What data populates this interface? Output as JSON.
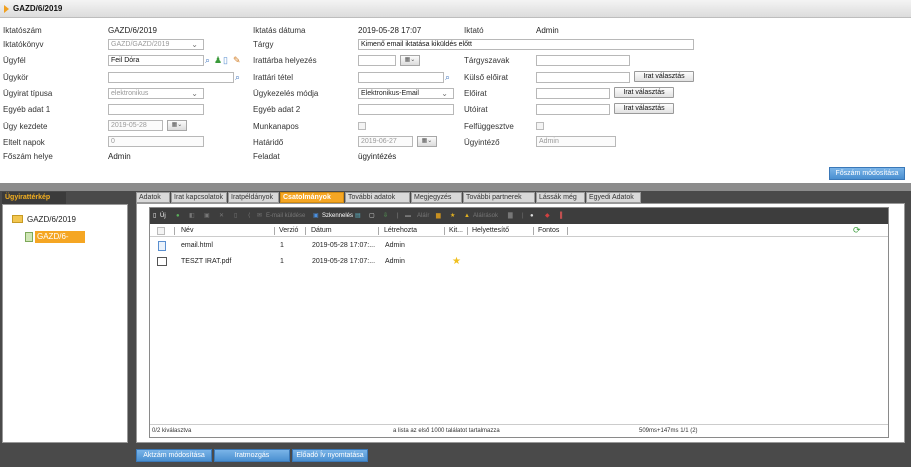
{
  "header": {
    "title": "GAZD/6/2019"
  },
  "form": {
    "iktatoszam": {
      "label": "Iktatószám",
      "value": "GAZD/6/2019"
    },
    "iktatokonyv": {
      "label": "Iktatókönyv",
      "value": "GAZD/GAZD/2019"
    },
    "ugyfel": {
      "label": "Ügyfél",
      "value": "Feil Dóra"
    },
    "ugykor": {
      "label": "Ügykör",
      "value": ""
    },
    "ugyirat_tipusa": {
      "label": "Ügyirat típusa",
      "value": "elektronikus"
    },
    "egyeb_adat_1": {
      "label": "Egyéb adat 1",
      "value": ""
    },
    "ugy_kezdete": {
      "label": "Ügy kezdete",
      "value": "2019-05-28"
    },
    "eltelt_napok": {
      "label": "Eltelt napok",
      "value": "0"
    },
    "foszam_helye": {
      "label": "Főszám helye",
      "value": "Admin"
    },
    "iktatas_datuma": {
      "label": "Iktatás dátuma",
      "value": "2019-05-28 17:07"
    },
    "targy": {
      "label": "Tárgy",
      "value": "Kimenő email iktatása kiküldés előtt"
    },
    "irattarba_helyezes": {
      "label": "Irattárba helyezés",
      "value": ""
    },
    "irattari_tetel": {
      "label": "Irattári tétel",
      "value": ""
    },
    "ugykezeles_modja": {
      "label": "Ügykezelés módja",
      "value": "Elektronikus-Email"
    },
    "egyeb_adat_2": {
      "label": "Egyéb adat 2",
      "value": ""
    },
    "munkanapos": {
      "label": "Munkanapos"
    },
    "hatarido": {
      "label": "Határidő",
      "value": "2019-06-27"
    },
    "feladat": {
      "label": "Feladat",
      "value": "ügyintézés"
    },
    "iktato": {
      "label": "Iktató",
      "value": "Admin"
    },
    "targyszavak": {
      "label": "Tárgyszavak",
      "value": ""
    },
    "kulso_eloirat": {
      "label": "Külső előirat",
      "value": ""
    },
    "eloirat": {
      "label": "Előirat",
      "value": ""
    },
    "utoirat": {
      "label": "Utóirat",
      "value": ""
    },
    "felfuggesztve": {
      "label": "Felfüggesztve"
    },
    "ugyintezo": {
      "label": "Ügyintéző",
      "value": "Admin"
    },
    "irat_valasztas": "Irat választás",
    "cal_icon": "calendar-icon"
  },
  "foszam_modositasa": "Főszám módosítása",
  "left": {
    "tab": "Ügyirattérkép",
    "root": "GAZD/6/2019",
    "child": "GAZD/6-1/2019"
  },
  "tabs": [
    "Adatok",
    "Irat kapcsolatok",
    "Iratpéldányok",
    "Csatolmányok",
    "További adatok",
    "Megjegyzés",
    "További partnerek",
    "Lássák még",
    "Egyedi Adatok"
  ],
  "active_tab": "Csatolmányok",
  "toolbar": {
    "uj": "Új",
    "email_kuldese": "E-mail küldése",
    "szkenneles": "Szkennelés",
    "alair": "Aláír",
    "alairasok": "Aláírások"
  },
  "grid": {
    "columns": [
      "Név",
      "Verzió",
      "Dátum",
      "Létrehozta",
      "Kit...",
      "Helyettesítő",
      "Fontos"
    ],
    "rows": [
      {
        "nev": "email.html",
        "verzio": "1",
        "datum": "2019-05-28 17:07:...",
        "letrehozta": "Admin",
        "starred": false
      },
      {
        "nev": "TESZT IRAT.pdf",
        "verzio": "1",
        "datum": "2019-05-28 17:07:...",
        "letrehozta": "Admin",
        "starred": true
      }
    ],
    "footer_left": "0/2 kiválasztva",
    "footer_mid": "a lista az első 1000 találatot tartalmazza",
    "footer_right": "509ms+147ms 1/1 (2)"
  },
  "bottom_buttons": [
    "Aktzám módosítása",
    "Iratmozgás",
    "Előadó Ív nyomtatása"
  ],
  "colors": {
    "accent": "#f5a623",
    "blue_button": "#4a8fd0",
    "dark_band": "#4a4a4a"
  }
}
